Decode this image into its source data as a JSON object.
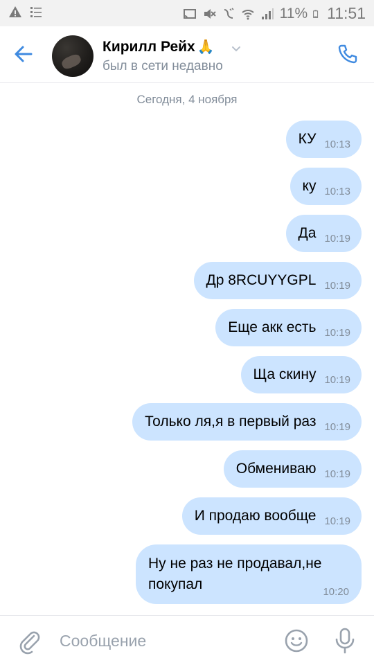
{
  "status_bar": {
    "battery": "11%",
    "time": "11:51",
    "icons": [
      "warning-icon",
      "list-icon",
      "cast-icon",
      "mute-icon",
      "vibrate-icon",
      "wifi-icon",
      "signal-icon",
      "battery-icon"
    ]
  },
  "header": {
    "name": "Кирилл Рейх",
    "emoji": "🙏",
    "status": "был в сети недавно",
    "accent": "#3f8ae0"
  },
  "chat": {
    "date": "Сегодня, 4 ноября",
    "bubble_color": "#cce4ff",
    "messages": [
      {
        "text": "КУ",
        "time": "10:13"
      },
      {
        "text": "ку",
        "time": "10:13"
      },
      {
        "text": "Да",
        "time": "10:19"
      },
      {
        "text": "Др 8RCUYYGPL",
        "time": "10:19"
      },
      {
        "text": "Еще акк есть",
        "time": "10:19"
      },
      {
        "text": "Ща скину",
        "time": "10:19"
      },
      {
        "text": "Только ля,я в первый раз",
        "time": "10:19"
      },
      {
        "text": "Обмениваю",
        "time": "10:19"
      },
      {
        "text": "И продаю вообще",
        "time": "10:19"
      },
      {
        "text": "Ну не раз не продавал,не покупал",
        "time": "10:20"
      }
    ]
  },
  "composer": {
    "placeholder": "Сообщение"
  }
}
